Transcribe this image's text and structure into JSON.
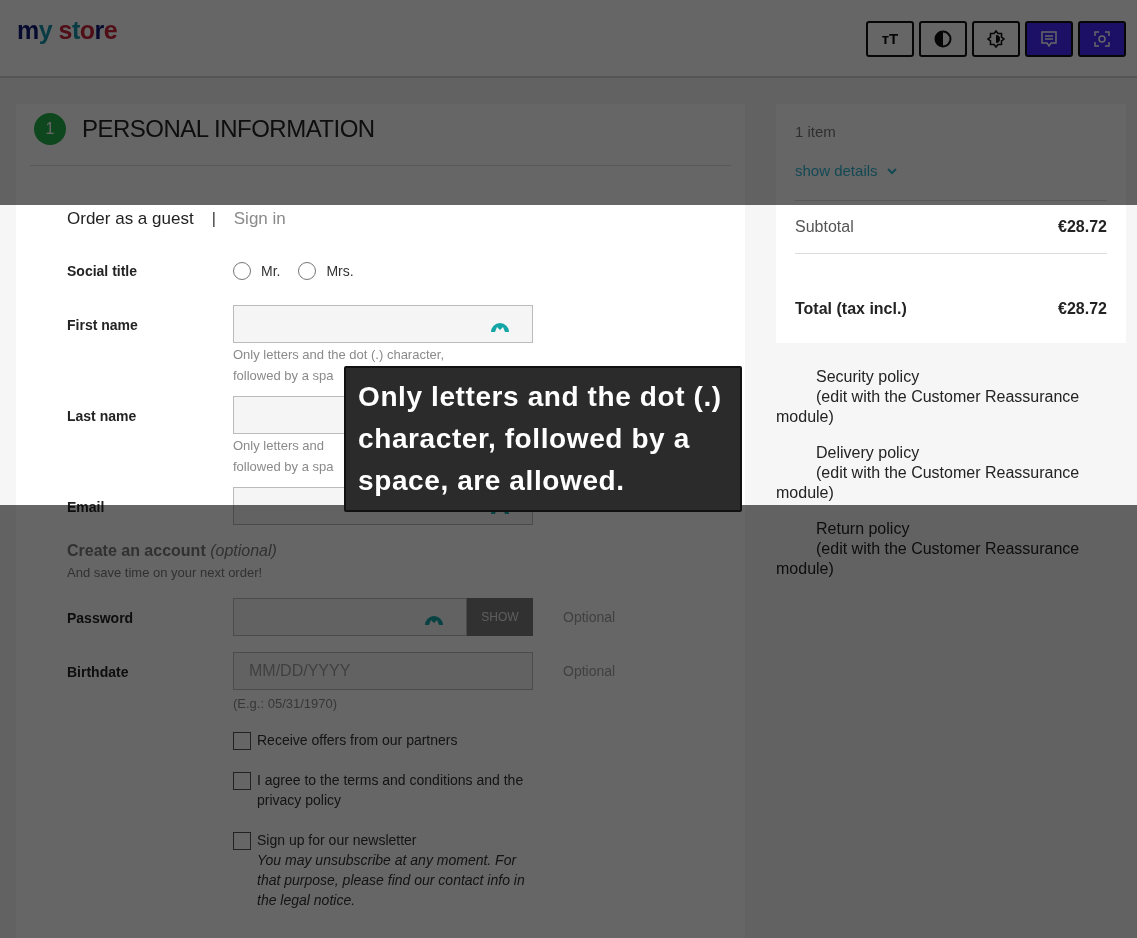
{
  "header": {
    "logo": "my store",
    "tools": [
      {
        "kind": "text-size",
        "label": "ᴛT",
        "active": false
      },
      {
        "kind": "contrast",
        "active": false
      },
      {
        "kind": "brightness",
        "active": false
      },
      {
        "kind": "tooltip",
        "active": true
      },
      {
        "kind": "reading-mask",
        "active": true
      }
    ]
  },
  "step": {
    "number": "1",
    "title": "PERSONAL INFORMATION"
  },
  "tabs": [
    {
      "label": "Order as a guest",
      "selected": true
    },
    {
      "label": "Sign in",
      "selected": false
    }
  ],
  "tab_separator": "|",
  "social_title": {
    "label": "Social title",
    "options": [
      {
        "label": "Mr.",
        "selected": false
      },
      {
        "label": "Mrs.",
        "selected": false
      }
    ]
  },
  "fields": [
    {
      "kind": "input",
      "label": "First name",
      "autofill_icon": true,
      "hint_lines": [
        "Only letters and the dot (.) character,",
        "followed by a spa"
      ]
    },
    {
      "kind": "input",
      "label": "Last name",
      "hint_lines": [
        "Only letters and",
        "followed by a spa"
      ]
    },
    {
      "kind": "input",
      "label": "Email",
      "autofill_icon": true
    },
    {
      "kind": "heading",
      "label": "Create an account",
      "note": "(optional)",
      "subtitle": "And save time on your next order!"
    },
    {
      "kind": "password",
      "label": "Password",
      "button": "SHOW",
      "optional": "Optional"
    },
    {
      "kind": "date",
      "label": "Birthdate",
      "placeholder": "MM/DD/YYYY",
      "optional": "Optional",
      "hint": "(E.g.: 05/31/1970)"
    }
  ],
  "checkboxes": [
    {
      "label": "Receive offers from our partners",
      "checked": false
    },
    {
      "label": "I agree to the terms and conditions and the privacy policy",
      "checked": false
    },
    {
      "label": "Sign up for our newsletter",
      "note": "You may unsubscribe at any moment. For that purpose, please find our contact info in the legal notice.",
      "checked": false
    }
  ],
  "summary": {
    "items": "1 item",
    "details_link": "show details",
    "subtotal_label": "Subtotal",
    "subtotal_value": "€28.72",
    "total_label": "Total (tax incl.)",
    "total_value": "€28.72"
  },
  "reassurance": [
    {
      "title": "Security policy",
      "note": "(edit with the Customer Reassurance module)"
    },
    {
      "title": "Delivery policy",
      "note": "(edit with the Customer Reassurance module)"
    },
    {
      "title": "Return policy",
      "note": "(edit with the Customer Reassurance module)"
    }
  ],
  "tooltip": "Only letters and the dot (.) character, followed by a space, are allowed."
}
